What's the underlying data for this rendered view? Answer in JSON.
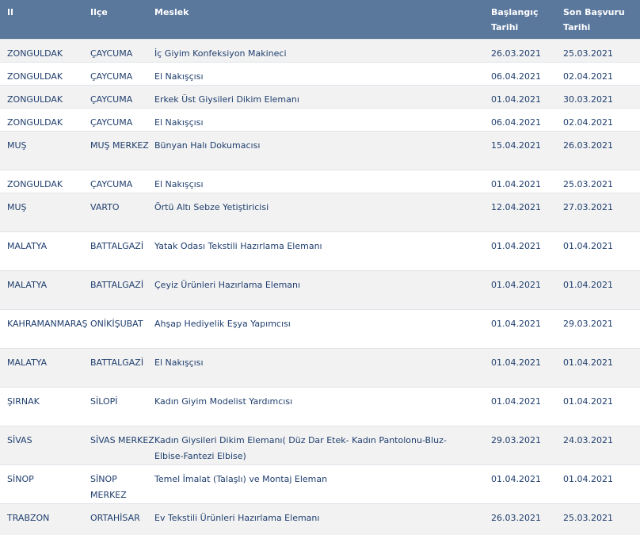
{
  "table": {
    "headers": {
      "il": "Il",
      "ilce": "Ilçe",
      "meslek": "Meslek",
      "baslangic": "Başlangıç Tarihi",
      "son_basvuru": "Son Başvuru Tarihi"
    },
    "rows": [
      {
        "il": "ZONGULDAK",
        "ilce": "ÇAYCUMA",
        "meslek": "İç Giyim Konfeksiyon Makineci",
        "baslangic": "26.03.2021",
        "son_basvuru": "25.03.2021"
      },
      {
        "il": "ZONGULDAK",
        "ilce": "ÇAYCUMA",
        "meslek": "El Nakışçısı",
        "baslangic": "06.04.2021",
        "son_basvuru": "02.04.2021"
      },
      {
        "il": "ZONGULDAK",
        "ilce": "ÇAYCUMA",
        "meslek": "Erkek Üst Giysileri Dikim Elemanı",
        "baslangic": "01.04.2021",
        "son_basvuru": "30.03.2021"
      },
      {
        "il": "ZONGULDAK",
        "ilce": "ÇAYCUMA",
        "meslek": "El Nakışçısı",
        "baslangic": "06.04.2021",
        "son_basvuru": "02.04.2021"
      },
      {
        "il": "MUŞ",
        "ilce": "MUŞ MERKEZ",
        "meslek": "Bünyan Halı Dokumacısı",
        "baslangic": "15.04.2021",
        "son_basvuru": "26.03.2021"
      },
      {
        "il": "ZONGULDAK",
        "ilce": "ÇAYCUMA",
        "meslek": "El Nakışçısı",
        "baslangic": "01.04.2021",
        "son_basvuru": "25.03.2021"
      },
      {
        "il": "MUŞ",
        "ilce": "VARTO",
        "meslek": "Örtü Altı Sebze Yetiştiricisi",
        "baslangic": "12.04.2021",
        "son_basvuru": "27.03.2021"
      },
      {
        "il": "MALATYA",
        "ilce": "BATTALGAZİ",
        "meslek": "Yatak Odası Tekstili Hazırlama Elemanı",
        "baslangic": "01.04.2021",
        "son_basvuru": "01.04.2021"
      },
      {
        "il": "MALATYA",
        "ilce": "BATTALGAZİ",
        "meslek": "Çeyiz Ürünleri Hazırlama Elemanı",
        "baslangic": "01.04.2021",
        "son_basvuru": "01.04.2021"
      },
      {
        "il": "KAHRAMANMARAŞ",
        "ilce": "ONİKİŞUBAT",
        "meslek": "Ahşap Hediyelik Eşya Yapımcısı",
        "baslangic": "01.04.2021",
        "son_basvuru": "29.03.2021"
      },
      {
        "il": "MALATYA",
        "ilce": "BATTALGAZİ",
        "meslek": "El Nakışçısı",
        "baslangic": "01.04.2021",
        "son_basvuru": "01.04.2021"
      },
      {
        "il": "ŞIRNAK",
        "ilce": "SİLOPİ",
        "meslek": "Kadın Giyim Modelist Yardımcısı",
        "baslangic": "01.04.2021",
        "son_basvuru": "01.04.2021"
      },
      {
        "il": "SİVAS",
        "ilce": "SİVAS MERKEZ",
        "meslek": "Kadın Giysileri Dikim Elemanı( Düz Dar Etek- Kadın Pantolonu-Bluz-Elbise-Fantezi Elbise)",
        "baslangic": "29.03.2021",
        "son_basvuru": "24.03.2021"
      },
      {
        "il": "SİNOP",
        "ilce": "SİNOP MERKEZ",
        "meslek": "Temel İmalat (Talaşlı) ve Montaj Eleman",
        "baslangic": "01.04.2021",
        "son_basvuru": "01.04.2021"
      },
      {
        "il": "TRABZON",
        "ilce": "ORTAHİSAR",
        "meslek": "Ev Tekstili Ürünleri Hazırlama Elemanı",
        "baslangic": "26.03.2021",
        "son_basvuru": "25.03.2021"
      }
    ]
  }
}
